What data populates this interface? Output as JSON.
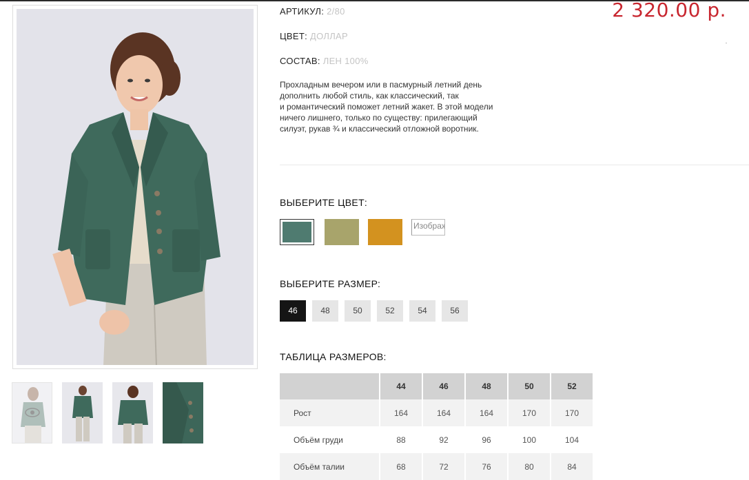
{
  "product": {
    "price": "2 320.00 р.",
    "article_label": "АРТИКУЛ:",
    "article_value": "2/80",
    "color_label": "ЦВЕТ:",
    "color_value": "ДОЛЛАР",
    "composition_label": "СОСТАВ:",
    "composition_value": "ЛЕН 100%",
    "description_lines": [
      "Прохладным вечером или в пасмурный летний день",
      "дополнить любой стиль, как классический, так",
      "и романтический поможет летний жакет. В этой модели",
      "ничего лишнего, только по существу: прилегающий",
      "силуэт, рукав ¾ и классический отложной воротник."
    ]
  },
  "color_picker": {
    "title": "ВЫБЕРИТЕ ЦВЕТ:",
    "swatches": [
      {
        "color": "#4f7b70",
        "selected": true
      },
      {
        "color": "#a8a46b",
        "selected": false
      },
      {
        "color": "#d3921f",
        "selected": false
      }
    ],
    "image_placeholder": "Изображение"
  },
  "size_picker": {
    "title": "ВЫБЕРИТЕ РАЗМЕР:",
    "sizes": [
      "46",
      "48",
      "50",
      "52",
      "54",
      "56"
    ],
    "selected": "46"
  },
  "size_table": {
    "title": "ТАБЛИЦА РАЗМЕРОВ:",
    "columns": [
      "44",
      "46",
      "48",
      "50",
      "52"
    ],
    "rows": [
      {
        "label": "Рост",
        "values": [
          "164",
          "164",
          "164",
          "170",
          "170"
        ]
      },
      {
        "label": "Объём груди",
        "values": [
          "88",
          "92",
          "96",
          "100",
          "104"
        ]
      },
      {
        "label": "Объём талии",
        "values": [
          "68",
          "72",
          "76",
          "80",
          "84"
        ]
      }
    ]
  },
  "colors": {
    "price": "#c8262f",
    "jacket": "#3f6a5c",
    "selected_size_bg": "#151515"
  },
  "gallery": {
    "icons": [
      "eye-icon"
    ]
  }
}
